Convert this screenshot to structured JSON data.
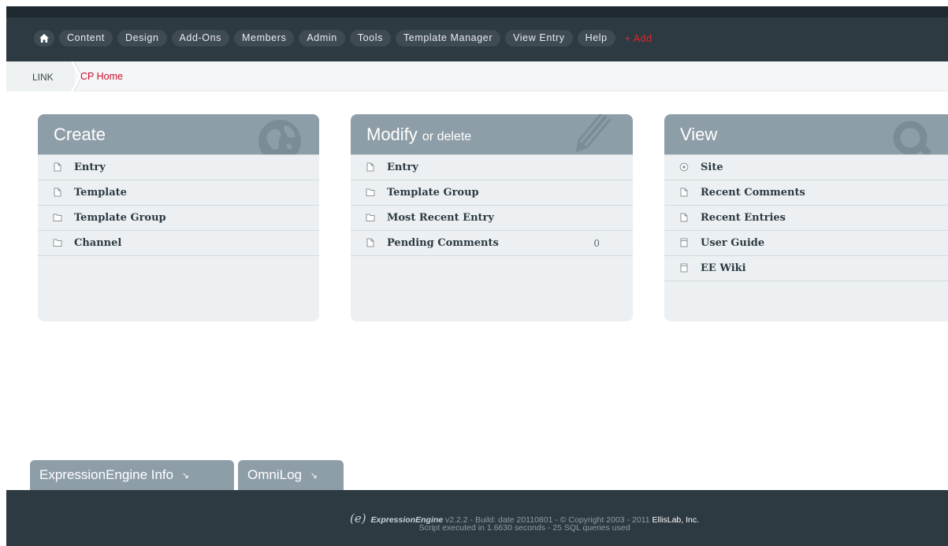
{
  "nav": {
    "home_icon": "home-icon",
    "items": [
      "Content",
      "Design",
      "Add-Ons",
      "Members",
      "Admin",
      "Tools",
      "Template Manager",
      "View Entry",
      "Help"
    ],
    "add_label": "+ Add"
  },
  "breadcrumb": {
    "first": "LINK",
    "current": "CP Home"
  },
  "panels": {
    "create": {
      "title": "Create",
      "icon": "globe-icon",
      "items": [
        {
          "label": "Entry",
          "icon": "document-icon"
        },
        {
          "label": "Template",
          "icon": "document-icon"
        },
        {
          "label": "Template Group",
          "icon": "folder-icon"
        },
        {
          "label": "Channel",
          "icon": "folder-icon"
        }
      ]
    },
    "modify": {
      "title": "Modify",
      "title_sub": "or delete",
      "icon": "pencil-icon",
      "items": [
        {
          "label": "Entry",
          "icon": "document-icon"
        },
        {
          "label": "Template Group",
          "icon": "folder-icon"
        },
        {
          "label": "Most Recent Entry",
          "icon": "folder-icon"
        },
        {
          "label": "Pending Comments",
          "icon": "document-icon",
          "count": "0"
        }
      ]
    },
    "view": {
      "title": "View",
      "icon": "magnifier-icon",
      "items": [
        {
          "label": "Site",
          "icon": "target-icon"
        },
        {
          "label": "Recent Comments",
          "icon": "document-icon"
        },
        {
          "label": "Recent Entries",
          "icon": "document-icon"
        },
        {
          "label": "User Guide",
          "icon": "book-icon"
        },
        {
          "label": "EE Wiki",
          "icon": "book-icon"
        }
      ]
    }
  },
  "tabs": {
    "info": "ExpressionEngine Info",
    "omnilog": "OmniLog"
  },
  "footer": {
    "logo": "(e)",
    "brand": "ExpressionEngine",
    "version": "v2.2.2 - Build: date  20110801 - © Copyright 2003 - 2011",
    "company": "EllisLab, Inc.",
    "line2": "Script executed in 1.6630 seconds - 25 SQL queries used"
  },
  "colors": {
    "nav_bg": "#2e3a41",
    "panel_head": "#8e9ea8",
    "panel_body": "#ecf0f2",
    "accent_red": "#c8102e"
  }
}
